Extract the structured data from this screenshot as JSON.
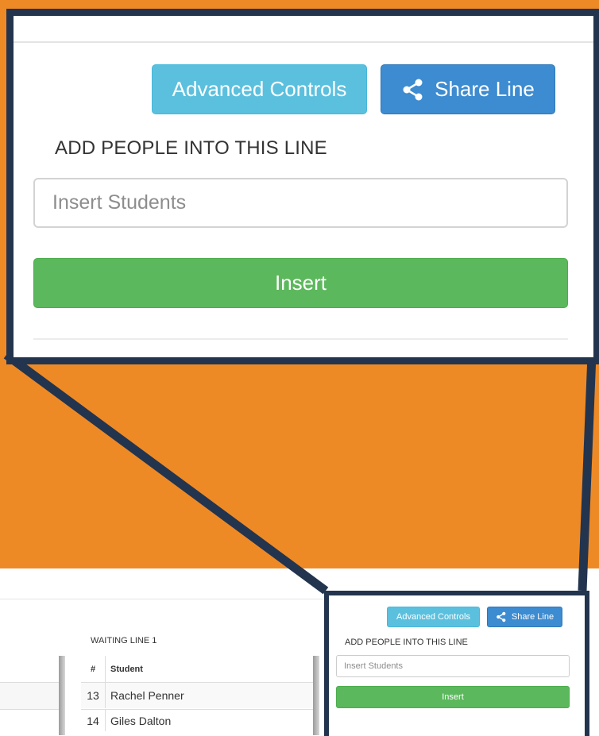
{
  "zoom": {
    "advanced_label": "Advanced Controls",
    "share_label": "Share Line",
    "heading": "ADD PEOPLE INTO THIS LINE",
    "input_placeholder": "Insert Students",
    "insert_label": "Insert"
  },
  "waiting_line": {
    "title": "WAITING LINE 1",
    "headers": [
      "#",
      "Student"
    ],
    "rows": [
      {
        "num": "13",
        "name": "Rachel Penner"
      },
      {
        "num": "14",
        "name": "Giles Dalton"
      }
    ]
  },
  "panel": {
    "advanced_label": "Advanced Controls",
    "share_label": "Share Line",
    "heading": "ADD PEOPLE INTO THIS LINE",
    "input_placeholder": "Insert Students",
    "insert_label": "Insert"
  },
  "colors": {
    "background_orange": "#ee8a26",
    "frame_navy": "#23344e",
    "info_button": "#5bc0de",
    "primary_button": "#3d8bd0",
    "success_button": "#5cb85c"
  },
  "icons": {
    "share": "share-icon"
  }
}
